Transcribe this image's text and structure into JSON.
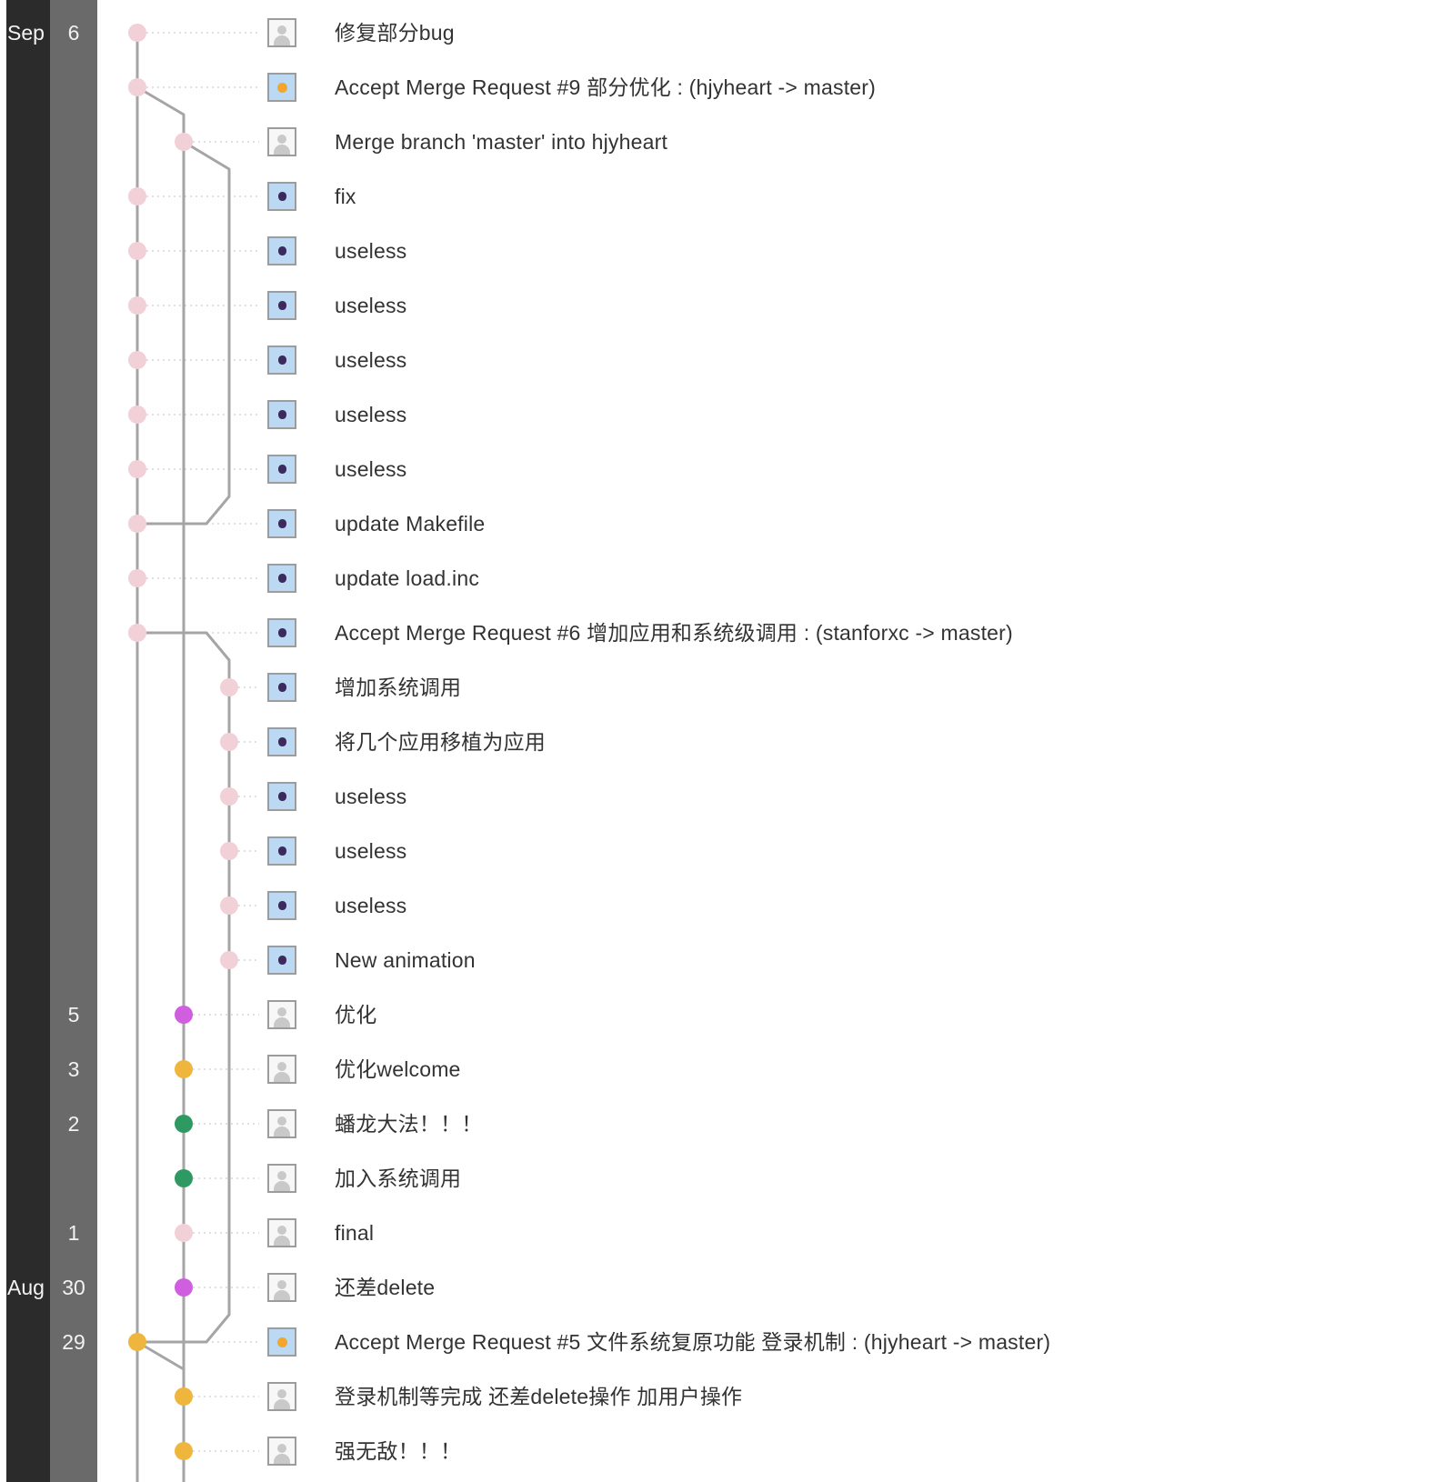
{
  "colors": {
    "month_column": "#2b2b2b",
    "day_column": "#6a6a6a",
    "graph_line": "#a5a5a5",
    "node_pink": "#f2d0d8",
    "node_orange": "#efb63e",
    "node_purple": "#cf5fdf",
    "node_green": "#2e9a61"
  },
  "dates": [
    {
      "row": 0,
      "month": "Sep",
      "day": "6"
    },
    {
      "row": 18,
      "month": "",
      "day": "5"
    },
    {
      "row": 19,
      "month": "",
      "day": "3"
    },
    {
      "row": 20,
      "month": "",
      "day": "2"
    },
    {
      "row": 22,
      "month": "",
      "day": "1"
    },
    {
      "row": 23,
      "month": "Aug",
      "day": "30"
    },
    {
      "row": 24,
      "month": "",
      "day": "29"
    }
  ],
  "commits": [
    {
      "message": "修复部分bug",
      "lane": 0,
      "node_color": "pink",
      "avatar": "default-avatar-icon"
    },
    {
      "message": "Accept Merge Request #9 部分优化 : (hjyheart -> master)",
      "lane": 0,
      "node_color": "pink",
      "avatar": "orange-avatar-icon"
    },
    {
      "message": "Merge branch 'master' into hjyheart",
      "lane": 1,
      "node_color": "pink",
      "avatar": "default-avatar-icon"
    },
    {
      "message": "fix",
      "lane": 0,
      "node_color": "pink",
      "avatar": "blue-avatar-icon"
    },
    {
      "message": "useless",
      "lane": 0,
      "node_color": "pink",
      "avatar": "blue-avatar-icon"
    },
    {
      "message": "useless",
      "lane": 0,
      "node_color": "pink",
      "avatar": "blue-avatar-icon"
    },
    {
      "message": "useless",
      "lane": 0,
      "node_color": "pink",
      "avatar": "blue-avatar-icon"
    },
    {
      "message": "useless",
      "lane": 0,
      "node_color": "pink",
      "avatar": "blue-avatar-icon"
    },
    {
      "message": "useless",
      "lane": 0,
      "node_color": "pink",
      "avatar": "blue-avatar-icon"
    },
    {
      "message": "update Makefile",
      "lane": 0,
      "node_color": "pink",
      "avatar": "blue-avatar-icon"
    },
    {
      "message": "update load.inc",
      "lane": 0,
      "node_color": "pink",
      "avatar": "blue-avatar-icon"
    },
    {
      "message": "Accept Merge Request #6 增加应用和系统级调用 : (stanforxc -> master)",
      "lane": 0,
      "node_color": "pink",
      "avatar": "blue-avatar-icon"
    },
    {
      "message": "增加系统调用",
      "lane": 2,
      "node_color": "pink",
      "avatar": "blue-avatar-icon"
    },
    {
      "message": "将几个应用移植为应用",
      "lane": 2,
      "node_color": "pink",
      "avatar": "blue-avatar-icon"
    },
    {
      "message": "useless",
      "lane": 2,
      "node_color": "pink",
      "avatar": "blue-avatar-icon"
    },
    {
      "message": "useless",
      "lane": 2,
      "node_color": "pink",
      "avatar": "blue-avatar-icon"
    },
    {
      "message": "useless",
      "lane": 2,
      "node_color": "pink",
      "avatar": "blue-avatar-icon"
    },
    {
      "message": "New animation",
      "lane": 2,
      "node_color": "pink",
      "avatar": "blue-avatar-icon"
    },
    {
      "message": "优化",
      "lane": 1,
      "node_color": "purple",
      "avatar": "default-avatar-icon"
    },
    {
      "message": "优化welcome",
      "lane": 1,
      "node_color": "orange",
      "avatar": "default-avatar-icon"
    },
    {
      "message": "蟠龙大法！！！",
      "lane": 1,
      "node_color": "green",
      "avatar": "default-avatar-icon"
    },
    {
      "message": "加入系统调用",
      "lane": 1,
      "node_color": "green",
      "avatar": "default-avatar-icon"
    },
    {
      "message": "final",
      "lane": 1,
      "node_color": "pink",
      "avatar": "default-avatar-icon"
    },
    {
      "message": "还差delete",
      "lane": 1,
      "node_color": "purple",
      "avatar": "default-avatar-icon"
    },
    {
      "message": "Accept Merge Request #5 文件系统复原功能 登录机制 : (hjyheart -> master)",
      "lane": 0,
      "node_color": "orange",
      "avatar": "orange-avatar-icon"
    },
    {
      "message": "登录机制等完成 还差delete操作 加用户操作",
      "lane": 1,
      "node_color": "orange",
      "avatar": "default-avatar-icon"
    },
    {
      "message": "强无敌！！！",
      "lane": 1,
      "node_color": "orange",
      "avatar": "default-avatar-icon"
    }
  ]
}
